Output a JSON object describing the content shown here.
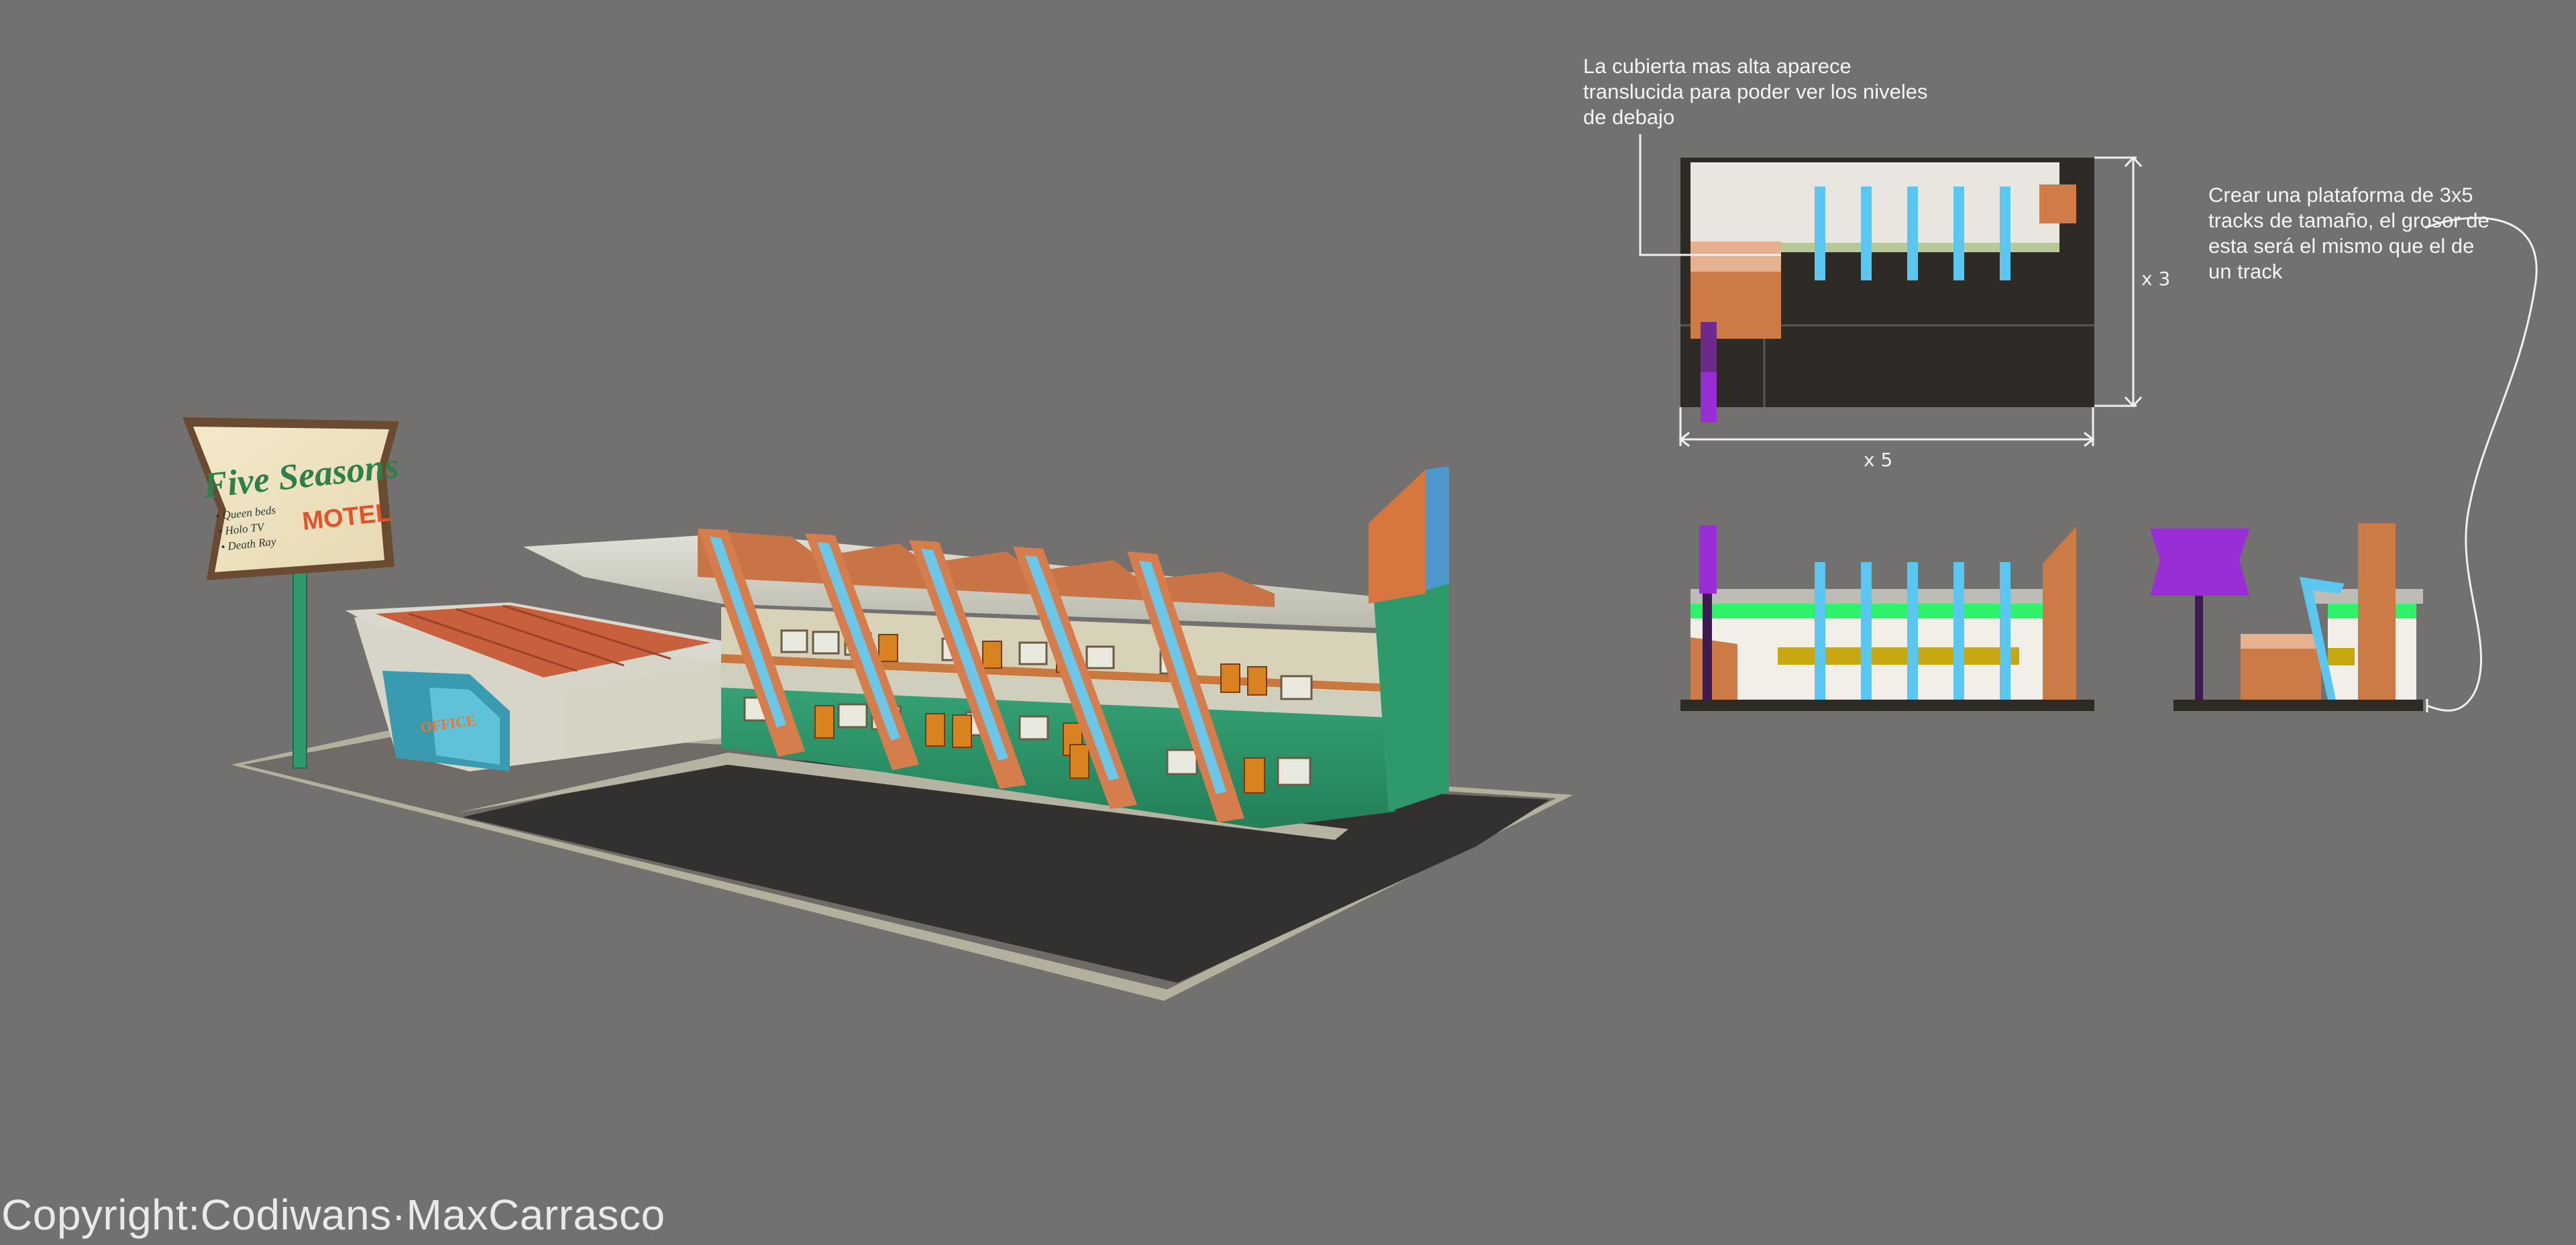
{
  "motel_sign": {
    "title": "Five Seasons",
    "subtitle": "MOTEL",
    "features": [
      "• Queen beds",
      "• Holo TV",
      "• Death Ray"
    ]
  },
  "office_sign": "OFFICE",
  "annotations": {
    "top_note": "La cubierta mas alta aparece\ntranslucida para poder ver los niveles\nde debajo",
    "right_note": "Crear una plataforma de 3x5\ntracks de tamaño, el grosor de\nesta será el mismo que el de\nun track",
    "dim_height": "x 3",
    "dim_width": "x 5"
  },
  "copyright": "Copyright:Codiwans·MaxCarrasco",
  "colors": {
    "background": "#727170",
    "teal": "#2f9a6c",
    "orange": "#d8793f",
    "sky_blue": "#5bc6f0",
    "purple": "#9a2ed6",
    "dark_platform": "#2e2b27",
    "green_band": "#2df26a",
    "yellow_band": "#c7a812"
  }
}
